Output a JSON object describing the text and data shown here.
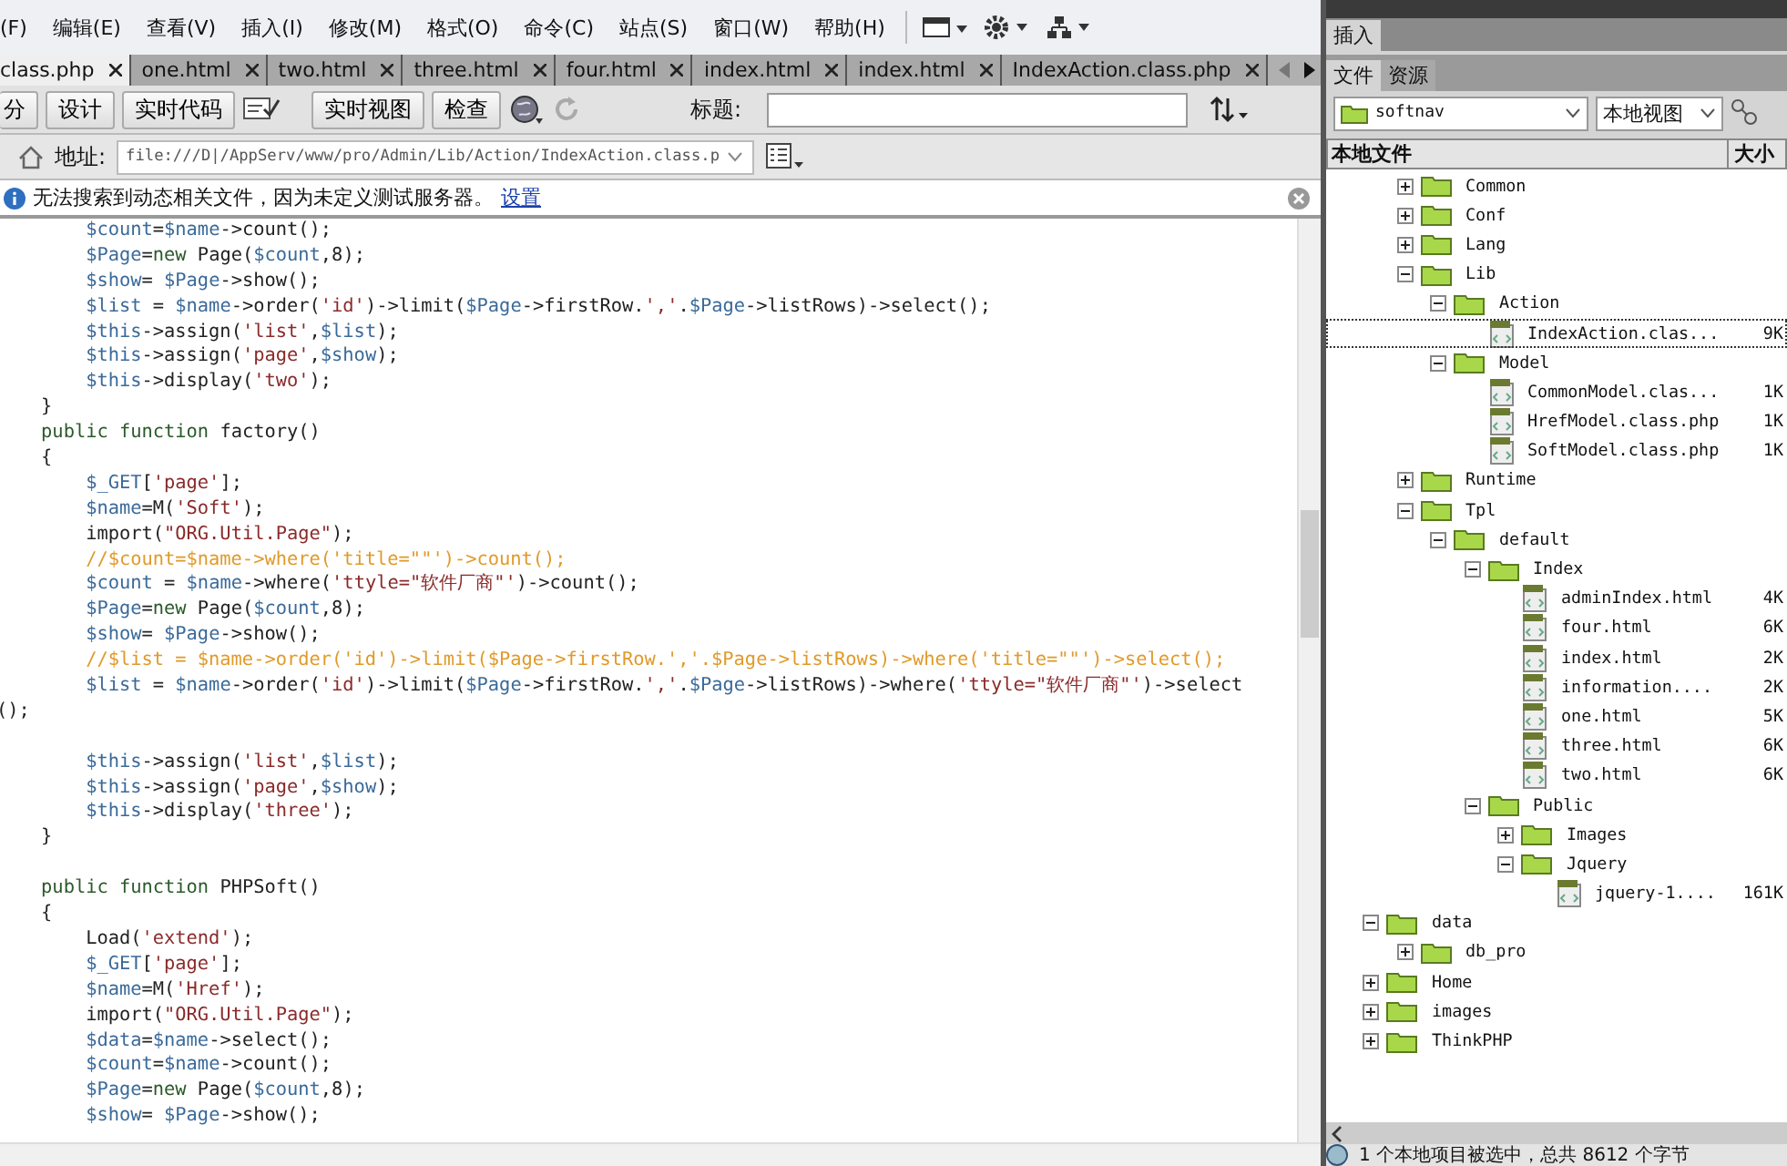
{
  "menu": [
    "(F)",
    "编辑(E)",
    "查看(V)",
    "插入(I)",
    "修改(M)",
    "格式(O)",
    "命令(C)",
    "站点(S)",
    "窗口(W)",
    "帮助(H)"
  ],
  "tabs": [
    {
      "label": "class.php",
      "selected": true
    },
    {
      "label": "one.html",
      "selected": false
    },
    {
      "label": "two.html",
      "selected": false
    },
    {
      "label": "three.html",
      "selected": false
    },
    {
      "label": "four.html",
      "selected": false
    },
    {
      "label": "index.html",
      "selected": false
    },
    {
      "label": "index.html",
      "selected": false
    },
    {
      "label": "IndexAction.class.php",
      "selected": false
    }
  ],
  "toolbar": {
    "buttons": [
      "分",
      "设计",
      "实时代码"
    ],
    "buttons2": [
      "实时视图",
      "检查"
    ],
    "title_label": "标题:"
  },
  "address": {
    "label": "地址:",
    "value": "file:///D|/AppServ/www/pro/Admin/Lib/Action/IndexAction.class.p"
  },
  "info_bar": {
    "message": "无法搜索到动态相关文件，因为未定义测试服务器。",
    "link": "设置"
  },
  "code_lines": [
    {
      "kind": "code",
      "text": "        $count=$name->count();"
    },
    {
      "kind": "code",
      "text": "        $Page=new Page($count,8);"
    },
    {
      "kind": "code",
      "text": "        $show= $Page->show();"
    },
    {
      "kind": "code",
      "text": "        $list = $name->order('id')->limit($Page->firstRow.','.$Page->listRows)->select();"
    },
    {
      "kind": "code",
      "text": "        $this->assign('list',$list);"
    },
    {
      "kind": "code",
      "text": "        $this->assign('page',$show);"
    },
    {
      "kind": "code",
      "text": "        $this->display('two');"
    },
    {
      "kind": "code",
      "text": "    }"
    },
    {
      "kind": "code",
      "text": "    public function factory()"
    },
    {
      "kind": "code",
      "text": "    {"
    },
    {
      "kind": "code",
      "text": "        $_GET['page'];"
    },
    {
      "kind": "code",
      "text": "        $name=M('Soft');"
    },
    {
      "kind": "code",
      "text": "        import(\"ORG.Util.Page\");"
    },
    {
      "kind": "comment",
      "text": "        //$count=$name->where('title=\"\"')->count();"
    },
    {
      "kind": "code",
      "text": "        $count = $name->where('ttyle=\"软件厂商\"')->count();"
    },
    {
      "kind": "code",
      "text": "        $Page=new Page($count,8);"
    },
    {
      "kind": "code",
      "text": "        $show= $Page->show();"
    },
    {
      "kind": "comment",
      "text": "        //$list = $name->order('id')->limit($Page->firstRow.','.$Page->listRows)->where('title=\"\"')->select();"
    },
    {
      "kind": "code",
      "text": "        $list = $name->order('id')->limit($Page->firstRow.','.$Page->listRows)->where('ttyle=\"软件厂商\"')->select"
    },
    {
      "kind": "code",
      "text": "();"
    },
    {
      "kind": "blank"
    },
    {
      "kind": "code",
      "text": "        $this->assign('list',$list);"
    },
    {
      "kind": "code",
      "text": "        $this->assign('page',$show);"
    },
    {
      "kind": "code",
      "text": "        $this->display('three');"
    },
    {
      "kind": "code",
      "text": "    }"
    },
    {
      "kind": "blank"
    },
    {
      "kind": "code",
      "text": "    public function PHPSoft()"
    },
    {
      "kind": "code",
      "text": "    {"
    },
    {
      "kind": "code",
      "text": "        Load('extend');"
    },
    {
      "kind": "code",
      "text": "        $_GET['page'];"
    },
    {
      "kind": "code",
      "text": "        $name=M('Href');"
    },
    {
      "kind": "code",
      "text": "        import(\"ORG.Util.Page\");"
    },
    {
      "kind": "code",
      "text": "        $data=$name->select();"
    },
    {
      "kind": "code",
      "text": "        $count=$name->count();"
    },
    {
      "kind": "code",
      "text": "        $Page=new Page($count,8);"
    },
    {
      "kind": "code",
      "text": "        $show= $Page->show();"
    }
  ],
  "panel": {
    "insert_tab": "插入",
    "tabs": [
      {
        "label": "文件",
        "selected": true
      },
      {
        "label": "资源",
        "selected": false
      }
    ],
    "site": "softnav",
    "view": "本地视图",
    "columns": [
      "本地文件",
      "大小"
    ],
    "tree": [
      {
        "kind": "offscreen",
        "children": [
          {
            "kind": "folder",
            "name": "Common",
            "expanded": false,
            "selected": false
          },
          {
            "kind": "folder",
            "name": "Conf",
            "expanded": false,
            "selected": false
          },
          {
            "kind": "folder",
            "name": "Lang",
            "expanded": false,
            "selected": false
          },
          {
            "kind": "folder",
            "name": "Lib",
            "expanded": true,
            "selected": false,
            "children": [
              {
                "kind": "folder",
                "name": "Action",
                "expanded": true,
                "selected": false,
                "children": [
                  {
                    "kind": "file",
                    "name": "IndexAction.clas...",
                    "size": "9K",
                    "selected": true
                  }
                ]
              },
              {
                "kind": "folder",
                "name": "Model",
                "expanded": true,
                "selected": false,
                "children": [
                  {
                    "kind": "file",
                    "name": "CommonModel.clas...",
                    "size": "1K",
                    "selected": false
                  },
                  {
                    "kind": "file",
                    "name": "HrefModel.class.php",
                    "size": "1K",
                    "selected": false
                  },
                  {
                    "kind": "file",
                    "name": "SoftModel.class.php",
                    "size": "1K",
                    "selected": false
                  }
                ]
              }
            ]
          },
          {
            "kind": "folder",
            "name": "Runtime",
            "expanded": false,
            "selected": false
          },
          {
            "kind": "folder",
            "name": "Tpl",
            "expanded": true,
            "selected": false,
            "children": [
              {
                "kind": "folder",
                "name": "default",
                "expanded": true,
                "selected": false,
                "children": [
                  {
                    "kind": "folder",
                    "name": "Index",
                    "expanded": true,
                    "selected": false,
                    "children": [
                      {
                        "kind": "file",
                        "name": "adminIndex.html",
                        "size": "4K",
                        "selected": false
                      },
                      {
                        "kind": "file",
                        "name": "four.html",
                        "size": "6K",
                        "selected": false
                      },
                      {
                        "kind": "file",
                        "name": "index.html",
                        "size": "2K",
                        "selected": false
                      },
                      {
                        "kind": "file",
                        "name": "information....",
                        "size": "2K",
                        "selected": false
                      },
                      {
                        "kind": "file",
                        "name": "one.html",
                        "size": "5K",
                        "selected": false
                      },
                      {
                        "kind": "file",
                        "name": "three.html",
                        "size": "6K",
                        "selected": false
                      },
                      {
                        "kind": "file",
                        "name": "two.html",
                        "size": "6K",
                        "selected": false
                      }
                    ]
                  },
                  {
                    "kind": "folder",
                    "name": "Public",
                    "expanded": true,
                    "selected": false,
                    "children": [
                      {
                        "kind": "folder",
                        "name": "Images",
                        "expanded": false,
                        "selected": false
                      },
                      {
                        "kind": "folder",
                        "name": "Jquery",
                        "expanded": true,
                        "selected": false,
                        "children": [
                          {
                            "kind": "file",
                            "name": "jquery-1....",
                            "size": "161K",
                            "selected": false
                          }
                        ]
                      }
                    ]
                  }
                ]
              }
            ]
          }
        ]
      },
      {
        "kind": "folder",
        "name": "data",
        "expanded": true,
        "selected": false,
        "children": [
          {
            "kind": "folder",
            "name": "db_pro",
            "expanded": false,
            "selected": false
          }
        ]
      },
      {
        "kind": "folder",
        "name": "Home",
        "expanded": false,
        "selected": false
      },
      {
        "kind": "folder",
        "name": "images",
        "expanded": false,
        "selected": false
      },
      {
        "kind": "folder",
        "name": "ThinkPHP",
        "expanded": false,
        "selected": false
      }
    ]
  },
  "status": "1 个本地项目被选中，总共 8612 个字节"
}
